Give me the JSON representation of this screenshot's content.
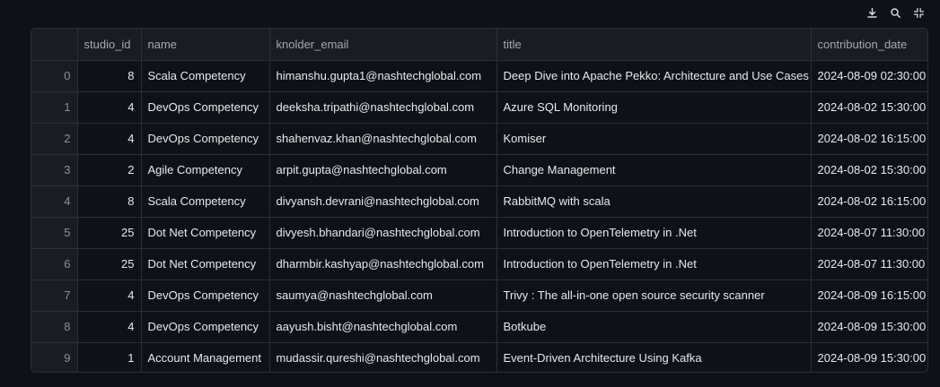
{
  "toolbar": {
    "icons": [
      "download-icon",
      "search-icon",
      "fullscreen-icon"
    ]
  },
  "table": {
    "columns": [
      "",
      "studio_id",
      "name",
      "knolder_email",
      "title",
      "contribution_date"
    ],
    "rows": [
      {
        "index": "0",
        "studio_id": "8",
        "name": "Scala Competency",
        "email": "himanshu.gupta1@nashtechglobal.com",
        "title": "Deep Dive into Apache Pekko: Architecture and Use Cases",
        "date": "2024-08-09 02:30:00"
      },
      {
        "index": "1",
        "studio_id": "4",
        "name": "DevOps Competency",
        "email": "deeksha.tripathi@nashtechglobal.com",
        "title": "Azure SQL Monitoring",
        "date": "2024-08-02 15:30:00"
      },
      {
        "index": "2",
        "studio_id": "4",
        "name": "DevOps Competency",
        "email": "shahenvaz.khan@nashtechglobal.com",
        "title": "Komiser",
        "date": "2024-08-02 16:15:00"
      },
      {
        "index": "3",
        "studio_id": "2",
        "name": "Agile Competency",
        "email": "arpit.gupta@nashtechglobal.com",
        "title": "Change Management",
        "date": "2024-08-02 15:30:00"
      },
      {
        "index": "4",
        "studio_id": "8",
        "name": "Scala Competency",
        "email": "divyansh.devrani@nashtechglobal.com",
        "title": "RabbitMQ with scala",
        "date": "2024-08-02 16:15:00"
      },
      {
        "index": "5",
        "studio_id": "25",
        "name": "Dot Net Competency",
        "email": "divyesh.bhandari@nashtechglobal.com",
        "title": "Introduction to OpenTelemetry in .Net",
        "date": "2024-08-07 11:30:00"
      },
      {
        "index": "6",
        "studio_id": "25",
        "name": "Dot Net Competency",
        "email": "dharmbir.kashyap@nashtechglobal.com",
        "title": "Introduction to OpenTelemetry in .Net",
        "date": "2024-08-07 11:30:00"
      },
      {
        "index": "7",
        "studio_id": "4",
        "name": "DevOps Competency",
        "email": "saumya@nashtechglobal.com",
        "title": "Trivy : The all-in-one open source security scanner",
        "date": "2024-08-09 16:15:00"
      },
      {
        "index": "8",
        "studio_id": "4",
        "name": "DevOps Competency",
        "email": "aayush.bisht@nashtechglobal.com",
        "title": "Botkube",
        "date": "2024-08-09 15:30:00"
      },
      {
        "index": "9",
        "studio_id": "1",
        "name": "Account Management",
        "email": "mudassir.qureshi@nashtechglobal.com",
        "title": "Event-Driven Architecture Using Kafka",
        "date": "2024-08-09 15:30:00"
      }
    ]
  }
}
